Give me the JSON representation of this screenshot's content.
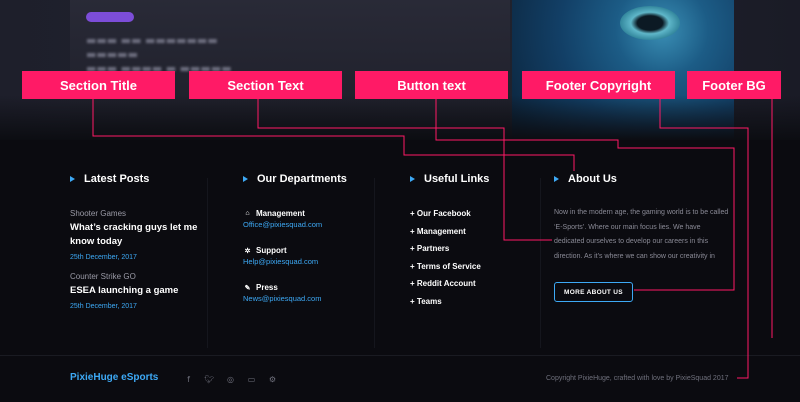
{
  "annotations": {
    "section_title": "Section Title",
    "section_text": "Section Text",
    "button_text": "Button text",
    "footer_copyright": "Footer Copyright",
    "footer_bg": "Footer BG"
  },
  "latest_posts": {
    "title": "Latest Posts",
    "posts": [
      {
        "category": "Shooter Games",
        "title": "What’s cracking guys let me know today",
        "date": "25th December, 2017"
      },
      {
        "category": "Counter Strike GO",
        "title": "ESEA launching a game",
        "date": "25th December, 2017"
      }
    ]
  },
  "departments": {
    "title": "Our Departments",
    "items": [
      {
        "name": "Management",
        "email": "Office@pixiesquad.com",
        "icon": "home-icon"
      },
      {
        "name": "Support",
        "email": "Help@pixiesquad.com",
        "icon": "support-icon"
      },
      {
        "name": "Press",
        "email": "News@pixiesquad.com",
        "icon": "pen-icon"
      }
    ]
  },
  "useful_links": {
    "title": "Useful Links",
    "links": [
      "+ Our Facebook",
      "+ Management",
      "+ Partners",
      "+ Terms of Service",
      "+ Reddit Account",
      "+ Teams"
    ]
  },
  "about": {
    "title": "About Us",
    "text": "Now in the modern age, the gaming world is to be called ‘E-Sports’. Where our main focus lies. We have dedicated ourselves to develop our careers in this direction. As it’s where we can show our creativity in",
    "button": "MORE ABOUT US"
  },
  "bottom": {
    "brand": "PixieHuge eSports",
    "copyright": "Copyright PixieHuge, crafted with love by PixieSquad 2017",
    "social": [
      "facebook-icon",
      "twitter-icon",
      "instagram-icon",
      "twitch-icon",
      "steam-icon"
    ]
  },
  "colors": {
    "accent": "#3da9f5",
    "annotation": "#ff1a66",
    "footer_bg": "#0b0b10"
  }
}
